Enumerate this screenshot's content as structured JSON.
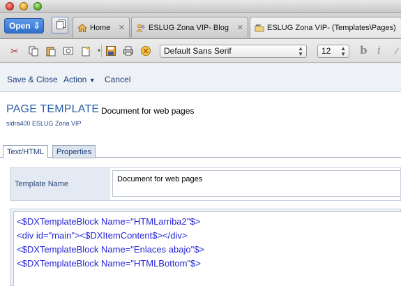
{
  "tabs": [
    {
      "label": "Home",
      "icon": "house-icon"
    },
    {
      "label": "ESLUG Zona VIP- Blog",
      "icon": "people-icon"
    },
    {
      "label": "ESLUG Zona VIP- (Templates\\Pages)",
      "icon": "folder-icon"
    }
  ],
  "open_button": {
    "label": "Open"
  },
  "toolbar": {
    "font_family": "Default Sans Serif",
    "font_size": "12",
    "bold_label": "b",
    "italic_label": "i"
  },
  "actions": {
    "save_close": "Save & Close",
    "action": "Action",
    "cancel": "Cancel"
  },
  "page": {
    "title": "PAGE TEMPLATE",
    "description": "Document for web pages",
    "subtitle": "sidra400  ESLUG Zona VIP"
  },
  "content_tabs": [
    {
      "label": "Text/HTML"
    },
    {
      "label": "Properties"
    }
  ],
  "form": {
    "template_name_label": "Template Name",
    "template_name_value": "Document for web pages"
  },
  "code_lines": [
    "<$DXTemplateBlock Name=\"HTMLarriba2\"$>",
    "<div id=\"main\"><$DXItemContent$></div>",
    "<$DXTemplateBlock Name=\"Enlaces abajo\"$>",
    "<$DXTemplateBlock Name=\"HTMLBottom\"$>"
  ],
  "colors": {
    "accent": "#2a5ea6",
    "code_text": "#2323d6",
    "open_button": "#3f7fd8"
  }
}
